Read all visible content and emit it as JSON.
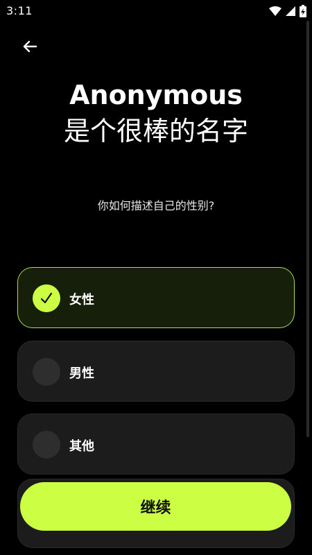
{
  "status_bar": {
    "time": "3:11",
    "icons": [
      "wifi-icon",
      "signal-icon",
      "battery-charging-icon"
    ]
  },
  "header": {
    "back_icon": "arrow-left-icon"
  },
  "title": {
    "line1": "Anonymous",
    "line2": "是个很棒的名字"
  },
  "question": "你如何描述自己的性别?",
  "options": [
    {
      "label": "女性",
      "selected": true
    },
    {
      "label": "男性",
      "selected": false
    },
    {
      "label": "其他",
      "selected": false
    }
  ],
  "continue_label": "继续",
  "colors": {
    "accent": "#ccff44",
    "background": "#000000",
    "card": "#1c1c1c",
    "selected_border": "#a8e04a"
  }
}
